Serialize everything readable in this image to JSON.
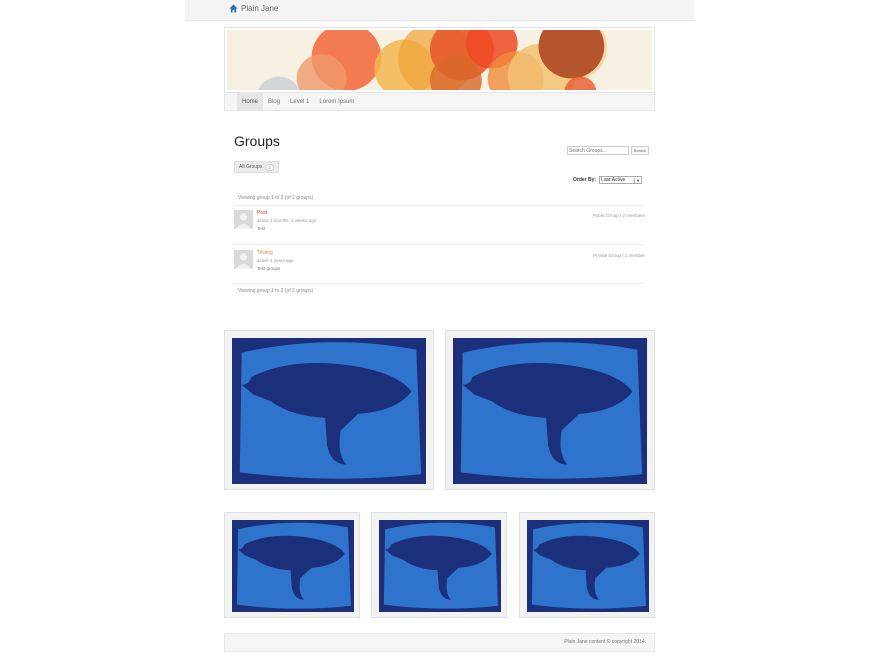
{
  "site": {
    "brand": "Plain Jane"
  },
  "nav": {
    "items": [
      "Home",
      "Blog",
      "Level 1",
      "Lorem Ipsum"
    ]
  },
  "page": {
    "title": "Groups",
    "search": {
      "placeholder": "Search Groups...",
      "button": "Search"
    },
    "tab": {
      "label": "All Groups",
      "count": "2"
    },
    "order": {
      "label": "Order By:",
      "value": "Last Active"
    },
    "viewing_top": "Viewing group 1 to 2 (of 2 groups)",
    "viewing_bottom": "Viewing group 1 to 2 (of 2 groups)"
  },
  "groups": [
    {
      "name": "Post",
      "active": "active 2 months, 3 weeks ago",
      "desc": "Test",
      "meta": "Public Group / 2 members"
    },
    {
      "name": "Testing",
      "active": "active 4 years ago",
      "desc": "Test groups",
      "meta": "Private Group / 1 member"
    }
  ],
  "footer": {
    "text": "Plain Jane content © copyright 2014."
  },
  "colors": {
    "accent_link": "#c0392b",
    "whale_bg": "#2a6bc4",
    "whale_dark": "#1b2f7a"
  }
}
